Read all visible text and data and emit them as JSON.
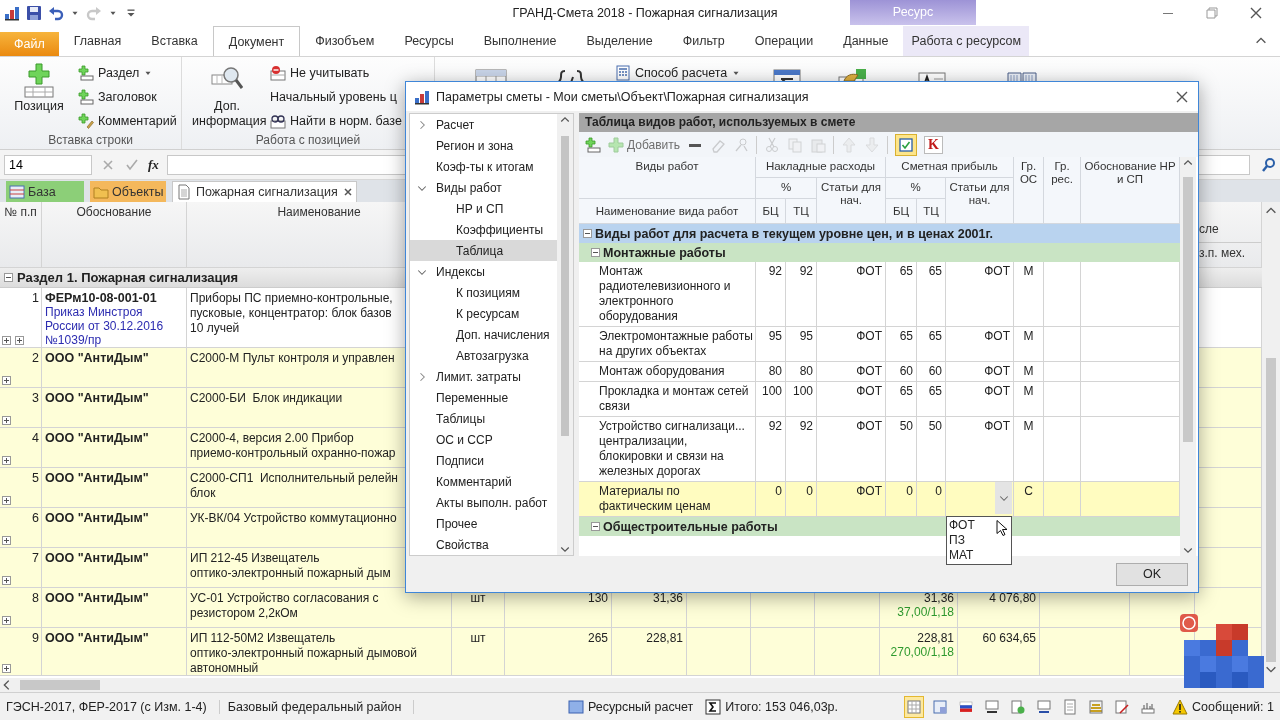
{
  "window": {
    "title": "ГРАНД-Смета 2018 - Пожарная сигнализация",
    "context_group": "Ресурс"
  },
  "ribbon_tabs": [
    {
      "label": "Файл",
      "kind": "file",
      "selected": false
    },
    {
      "label": "Главная",
      "kind": "plain",
      "selected": false
    },
    {
      "label": "Вставка",
      "kind": "plain",
      "selected": false
    },
    {
      "label": "Документ",
      "kind": "plain",
      "selected": true
    },
    {
      "label": "Физобъем",
      "kind": "plain",
      "selected": false
    },
    {
      "label": "Ресурсы",
      "kind": "plain",
      "selected": false
    },
    {
      "label": "Выполнение",
      "kind": "plain",
      "selected": false
    },
    {
      "label": "Выделение",
      "kind": "plain",
      "selected": false
    },
    {
      "label": "Фильтр",
      "kind": "plain",
      "selected": false
    },
    {
      "label": "Операции",
      "kind": "plain",
      "selected": false
    },
    {
      "label": "Данные",
      "kind": "plain",
      "selected": false
    },
    {
      "label": "Работа с ресурсом",
      "kind": "context",
      "selected": false
    }
  ],
  "ribbon": {
    "groups": [
      {
        "title": "Вставка строки",
        "big": "Позиция",
        "items": [
          {
            "label": "Раздел",
            "kind": "icon",
            "dropdown": true
          },
          {
            "label": "Заголовок",
            "kind": "icon",
            "dropdown": false
          },
          {
            "label": "Комментарий",
            "kind": "icon",
            "dropdown": false
          }
        ]
      },
      {
        "title": "Работа с позицией",
        "big": "Доп. информация",
        "items": [
          {
            "label": "Не учитывать",
            "kind": "icon",
            "dropdown": false
          },
          {
            "label": "Начальный уровень ц",
            "kind": "text",
            "dropdown": false
          },
          {
            "label": "Найти в норм. базе",
            "kind": "icon",
            "dropdown": false
          }
        ]
      },
      {
        "items": [
          {
            "label": "Способ расчета",
            "kind": "icon",
            "dropdown": true
          }
        ]
      }
    ]
  },
  "formula_bar": {
    "cell": "14",
    "function_label": "fx"
  },
  "doc_tabs": [
    {
      "label": "База",
      "color": "#8ccf78",
      "selected": false,
      "closable": false
    },
    {
      "label": "Объекты",
      "color": "#f4b85c",
      "selected": false,
      "closable": false
    },
    {
      "label": "Пожарная сигнализация",
      "color": "#ffffff",
      "selected": true,
      "closable": true
    }
  ],
  "sheet": {
    "columns": [
      "№ п.п",
      "Обоснование",
      "Наименование"
    ],
    "right_header": [
      "сле",
      "з.п. мех."
    ],
    "section": {
      "label": "Раздел 1. Пожарная сигнализация",
      "expanded": true
    },
    "rows": [
      {
        "kind": "norm",
        "num": "1",
        "basis": "ФЕРм10-08-001-01",
        "basis_note": "Приказ Минстроя России от 30.12.2016 №1039/пр",
        "name": "Приборы ПС приемно-контрольные,\nпусковые, концентратор: блок базов\n10 лучей",
        "expanded": false
      },
      {
        "kind": "material",
        "num": "2",
        "basis": "ООО \"АнтиДым\"",
        "name": "С2000-М Пульт контроля и управлен",
        "expanded": false
      },
      {
        "kind": "material",
        "num": "3",
        "basis": "ООО \"АнтиДым\"",
        "name": "С2000-БИ  Блок индикации",
        "expanded": false
      },
      {
        "kind": "material",
        "num": "4",
        "basis": "ООО \"АнтиДым\"",
        "name": "С2000-4, версия 2.00 Прибор\nприемо-контрольный охранно-пожар",
        "expanded": false
      },
      {
        "kind": "material",
        "num": "5",
        "basis": "ООО \"АнтиДым\"",
        "name": "С2000-СП1  Исполнительный релейн\nблок",
        "expanded": false
      },
      {
        "kind": "material",
        "num": "6",
        "basis": "ООО \"АнтиДым\"",
        "name": "УК-ВК/04 Устройство коммутационно",
        "expanded": false
      },
      {
        "kind": "material",
        "num": "7",
        "basis": "ООО \"АнтиДым\"",
        "name": "ИП 212-45 Извещатель\nоптико-электронный пожарный дым",
        "expanded": false
      },
      {
        "kind": "material",
        "num": "8",
        "basis": "ООО \"АнтиДым\"",
        "name": "УС-01 Устройство согласования с\nрезистором 2,2кОм",
        "unit": "шт",
        "qty": "130",
        "price": "31,36",
        "unit_total": "31,36",
        "unit_total_note": "37,00/1,18",
        "total": "4 076,80",
        "expanded": false
      },
      {
        "kind": "material",
        "num": "9",
        "basis": "ООО \"АнтиДым\"",
        "name": "ИП 112-50М2 Извещатель\nоптико-электронный пожарный дымовой\nавтономный",
        "unit": "шт",
        "qty": "265",
        "price": "228,81",
        "unit_total": "228,81",
        "unit_total_note": "270,00/1,18",
        "total": "60 634,65",
        "expanded": false
      }
    ]
  },
  "status_bar": {
    "norms": "ГЭСН-2017, ФЕР-2017 (с Изм. 1-4)",
    "region": "Базовый федеральный район",
    "mode": "Ресурсный расчет",
    "total": "Итого: 153 046,03р.",
    "tools": [
      {
        "selected": true
      },
      {
        "selected": false
      },
      {
        "selected": false
      },
      {
        "selected": false
      },
      {
        "selected": false
      },
      {
        "selected": false
      },
      {
        "selected": false
      },
      {
        "selected": false
      },
      {
        "selected": false
      },
      {
        "selected": false
      }
    ],
    "messages": "Сообщений: 1"
  },
  "dialog": {
    "title": "Параметры сметы - Мои сметы\\Объект\\Пожарная сигнализация",
    "nav": [
      {
        "label": "Расчет",
        "expanded": false,
        "selected": false
      },
      {
        "label": "Регион и зона",
        "selected": false
      },
      {
        "label": "Коэф-ты к итогам",
        "selected": false
      },
      {
        "label": "Виды работ",
        "expanded": true,
        "selected": false,
        "children": [
          {
            "label": "НР и СП",
            "selected": false
          },
          {
            "label": "Коэффициенты",
            "selected": false
          },
          {
            "label": "Таблица",
            "selected": true
          }
        ]
      },
      {
        "label": "Индексы",
        "expanded": true,
        "selected": false,
        "children": [
          {
            "label": "К позициям",
            "selected": false
          },
          {
            "label": "К ресурсам",
            "selected": false
          },
          {
            "label": "Доп. начисления",
            "selected": false
          },
          {
            "label": "Автозагрузка",
            "selected": false
          }
        ]
      },
      {
        "label": "Лимит. затраты",
        "expanded": false,
        "selected": false
      },
      {
        "label": "Переменные",
        "selected": false
      },
      {
        "label": "Таблицы",
        "selected": false
      },
      {
        "label": "ОС и ССР",
        "selected": false
      },
      {
        "label": "Подписи",
        "selected": false
      },
      {
        "label": "Комментарий",
        "selected": false
      },
      {
        "label": "Акты выполн. работ",
        "selected": false
      },
      {
        "label": "Прочее",
        "selected": false
      },
      {
        "label": "Свойства",
        "selected": false
      }
    ],
    "panel_title": "Таблица видов работ, используемых в смете",
    "toolbar": [
      {
        "kind": "button",
        "disabled": false
      },
      {
        "kind": "button",
        "label": "Добавить",
        "disabled": true
      },
      {
        "kind": "button",
        "disabled": false
      },
      {
        "kind": "button",
        "disabled": true
      },
      {
        "kind": "button",
        "disabled": true
      },
      {
        "kind": "separator"
      },
      {
        "kind": "button",
        "disabled": true
      },
      {
        "kind": "button",
        "disabled": true
      },
      {
        "kind": "button",
        "disabled": true
      },
      {
        "kind": "separator"
      },
      {
        "kind": "button",
        "disabled": true
      },
      {
        "kind": "button",
        "disabled": true
      },
      {
        "kind": "separator"
      },
      {
        "kind": "toggle",
        "on": true
      },
      {
        "kind": "toggle",
        "label": "K",
        "on": false
      }
    ],
    "header": {
      "name": "Виды работ",
      "name_sub": "Наименование вида работ",
      "overhead": {
        "label": "Накладные расходы",
        "percent": "%",
        "base": "БЦ",
        "current": "ТЦ",
        "items": "Статьи для нач."
      },
      "profit": {
        "label": "Сметная прибыль",
        "percent": "%",
        "base": "БЦ",
        "current": "ТЦ",
        "items": "Статьи для нач."
      },
      "group_os": "Гр. ОС",
      "group_res": "Гр. рес.",
      "basis": "Обоснование НР и СП"
    },
    "groups": [
      {
        "label": "Виды работ для расчета в текущем уровне цен, и в ценах 2001г.",
        "expanded": true,
        "children": [
          {
            "label": "Монтажные работы",
            "expanded": true,
            "rows": [
              {
                "name": "Монтаж радиотелевизионного и электронного оборудования",
                "nr_bc": "92",
                "nr_tc": "92",
                "nr_items": "ФОТ",
                "sp_bc": "65",
                "sp_tc": "65",
                "sp_items": "ФОТ",
                "gr_os": "М",
                "selected": false
              },
              {
                "name": "Электромонтажные работы на других объектах",
                "nr_bc": "95",
                "nr_tc": "95",
                "nr_items": "ФОТ",
                "sp_bc": "65",
                "sp_tc": "65",
                "sp_items": "ФОТ",
                "gr_os": "М",
                "selected": false
              },
              {
                "name": "Монтаж оборудования",
                "nr_bc": "80",
                "nr_tc": "80",
                "nr_items": "ФОТ",
                "sp_bc": "60",
                "sp_tc": "60",
                "sp_items": "ФОТ",
                "gr_os": "М",
                "selected": false
              },
              {
                "name": "Прокладка и монтаж сетей связи",
                "nr_bc": "100",
                "nr_tc": "100",
                "nr_items": "ФОТ",
                "sp_bc": "65",
                "sp_tc": "65",
                "sp_items": "ФОТ",
                "gr_os": "М",
                "selected": false
              },
              {
                "name": "Устройство сигнализаци... централизации, блокировки и связи на железных дорогах",
                "nr_bc": "92",
                "nr_tc": "92",
                "nr_items": "ФОТ",
                "sp_bc": "50",
                "sp_tc": "50",
                "sp_items": "ФОТ",
                "gr_os": "М",
                "selected": false
              },
              {
                "name": "Материалы по фактическим ценам",
                "nr_bc": "0",
                "nr_tc": "0",
                "nr_items": "ФОТ",
                "sp_bc": "0",
                "sp_tc": "0",
                "sp_items_editor": {
                  "open": true,
                  "options": [
                    "ФОТ",
                    "ПЗ",
                    "МАТ"
                  ]
                },
                "gr_os": "С",
                "selected": true
              }
            ]
          },
          {
            "label": "Общестроительные работы",
            "expanded": true
          }
        ]
      }
    ],
    "ok": "OK"
  }
}
